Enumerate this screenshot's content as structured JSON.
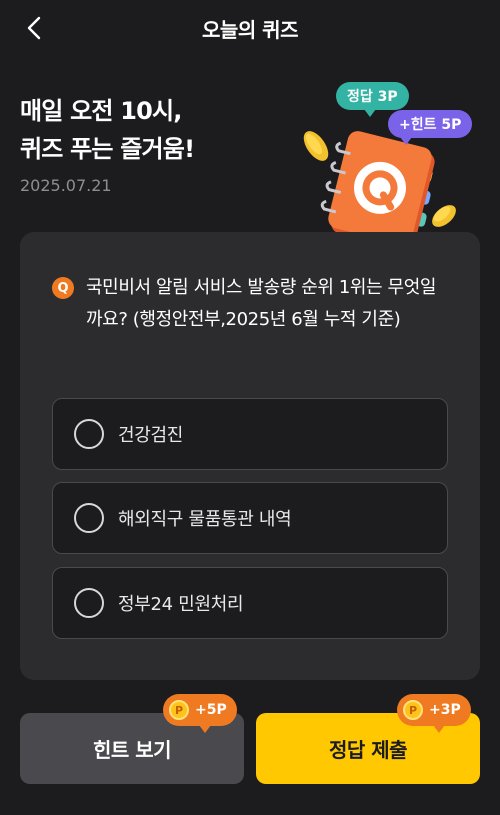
{
  "header": {
    "title": "오늘의 퀴즈",
    "back_icon": "chevron-left-icon"
  },
  "hero": {
    "line1": "매일 오전 10시,",
    "line2": "퀴즈 푸는 즐거움!",
    "date": "2025.07.21",
    "bubble_answer": "정답 3P",
    "bubble_hint": "+힌트 5P",
    "notebook_letter": "Q"
  },
  "question": {
    "badge": "Q",
    "text": "국민비서 알림 서비스 발송량 순위 1위는 무엇일까요? (행정안전부,2025년 6월 누적 기준)"
  },
  "options": [
    {
      "label": "건강검진"
    },
    {
      "label": "해외직구 물품통관 내역"
    },
    {
      "label": "정부24 민원처리"
    }
  ],
  "buttons": {
    "hint": {
      "label": "힌트 보기",
      "reward": "+5P",
      "coin": "P"
    },
    "submit": {
      "label": "정답 제출",
      "reward": "+3P",
      "coin": "P"
    }
  },
  "colors": {
    "background": "#1c1c1e",
    "card": "#2c2c2e",
    "accent_orange": "#f07a22",
    "submit_yellow": "#ffc800",
    "bubble_teal": "#33b3a4",
    "bubble_purple": "#7a63e8"
  }
}
